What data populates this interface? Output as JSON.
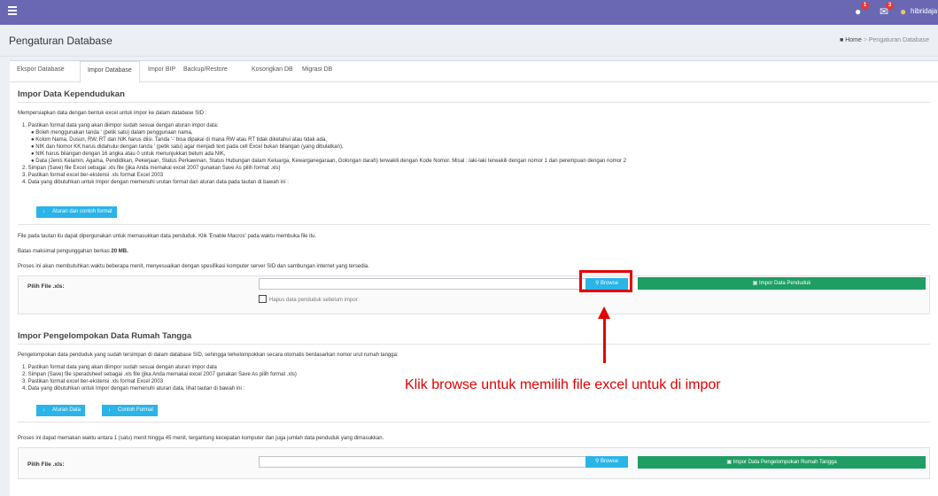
{
  "topbar": {
    "user_name": "hibridaja",
    "message_badge": "1",
    "mail_badge": "3",
    "bg_color": "#6a68b3"
  },
  "page": {
    "title": "Pengaturan Database",
    "breadcrumb_home": "Home",
    "breadcrumb_current": "Pengaturan Database"
  },
  "tabs": [
    {
      "label": "Ekspor Database"
    },
    {
      "label": "Impor Database"
    },
    {
      "label": "Impor BIP"
    },
    {
      "label": "Backup/Restore"
    },
    {
      "label": "Kosongkan DB"
    },
    {
      "label": "Migrasi DB"
    }
  ],
  "section1": {
    "heading": "Impor Data Kependudukan",
    "intro": "Mempersiapkan data dengan bentuk excel untuk impor ke dalam database SID :",
    "steps": [
      "1. Pastikan format data yang akan diimpor sudah sesuai dengan aturan impor data:",
      "2. Simpan (Save) file Excel sebagai .xls file (jika Anda memakai excel 2007 gunakan Save As pilih format .xls)",
      "3. Pastikan format excel ber-ekstensi .xls format Excel 2003",
      "4. Data yang dibutuhkan untuk Impor dengan memenuhi urutan format dan aturan data pada tautan di bawah ini :"
    ],
    "bullets": [
      "● Boleh menggunakan tanda ' (petik satu) dalam penggunaan nama,",
      "● Kolom Nama, Dusun, RW, RT dan NIK harus diisi. Tanda '-' bisa dipakai di mana RW atau RT tidak diketahui atau tidak ada,",
      "● NIK dan Nomor KK harus didahului dengan tanda ' (petik satu) agar menjadi text pada cell Excel bukan bilangan (yang dibulatkan),",
      "● NIK harus bilangan dengan 16 angka atau 0 untuk menunjukkan belum ada NIK,",
      "● Data (Jenis Kelamin, Agama, Pendidikan, Pekerjaan, Status Perkawinan, Status Hubungan dalam Keluarga, Kewarganegaraan, Golongan darah) terwakili dengan Kode Nomor. Misal : laki-laki terwakili dengan nomor 1 dan perempuan dengan nomor 2"
    ],
    "rules_button": "Aturan dan contoh format",
    "macro_note": "File pada tautan itu dapat dipergunakan untuk memasukkan data penduduk. Klik 'Enable Macros' pada waktu membuka file itu.",
    "max_size_prefix": "Batas maksimal pengunggahan berkas ",
    "max_size_value": "20 MB.",
    "process_note": "Proses ini akan membutuhkan waktu beberapa menit, menyesuaikan dengan spesifikasi komputer server SID dan sambungan internet yang tersedia.",
    "file_label": "Pilih File .xls:",
    "browse_button": "Browse",
    "import_button": "Impor Data Penduduk",
    "delete_checkbox_label": "Hapus data penduduk sebelum impor"
  },
  "section2": {
    "heading": "Impor Pengelompokan Data Rumah Tangga",
    "intro": "Pengelompokan data penduduk yang sudah tersimpan di dalam database SID, sehingga terkelompokkan secara otomatis berdasarkan nomor urut rumah tangga:",
    "steps": [
      "1. Pastikan format data yang akan diimpor sudah sesuai dengan aturan impor data",
      "2. Simpan (Save) file speradsheet sebagai .xls file (jika Anda memakai excel 2007 gunakan Save As pilih format .xls)",
      "3. Pastikan format excel ber-ekstensi .xls format Excel 2003",
      "4. Data yang dibutuhkan untuk Impor dengan memenuhi aturan data, lihat tautan di bawah ini :"
    ],
    "rules_button": "Aturan Data",
    "example_button": "Contoh Format",
    "process_note": "Proses ini dapat memakan waktu antara 1 (satu) menit hingga 45 menit, tergantung kecepatan komputer dan juga jumlah data penduduk yang dimasukkan.",
    "file_label": "Pilih File .xls:",
    "browse_button": "Browse",
    "import_button": "Impor Data Pengelompokan Rumah Tangga"
  },
  "annotation": {
    "callout_text": "Klik browse untuk memilih file excel untuk di impor",
    "color": "#e30000"
  },
  "icons": {
    "menu": "hamburger-icon",
    "search": "search-icon",
    "download": "download-icon",
    "upload": "upload-icon"
  }
}
